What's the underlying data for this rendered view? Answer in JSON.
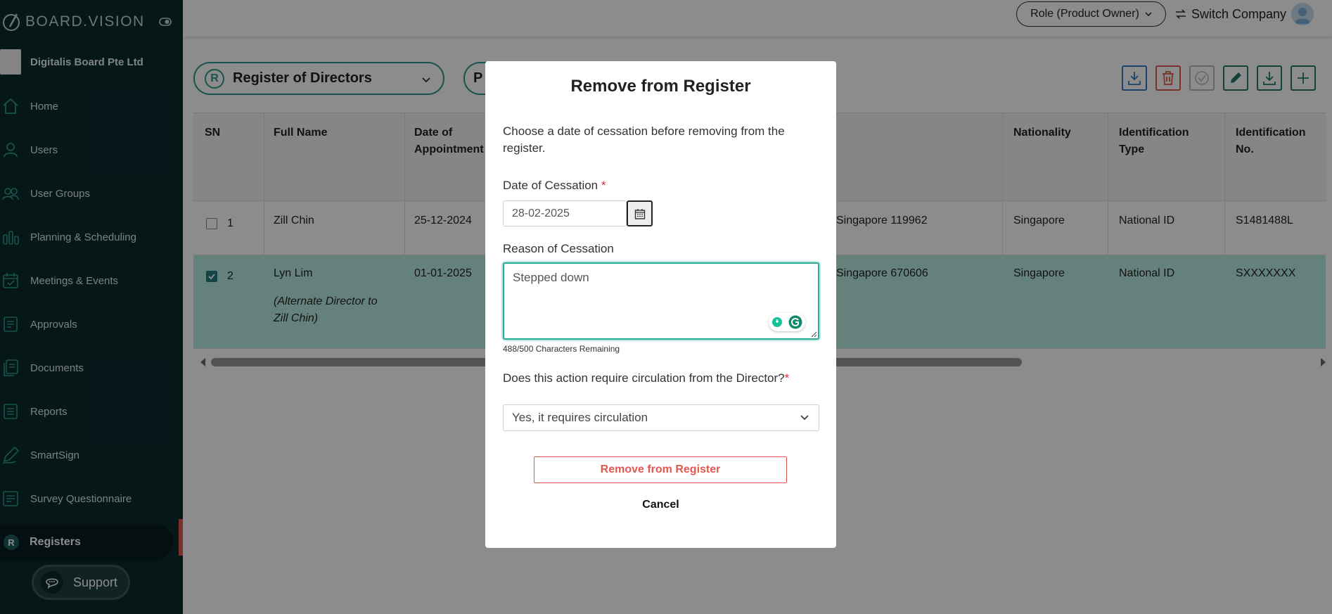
{
  "brand": {
    "name": "BOARD.VISION"
  },
  "company": {
    "name": "Digitalis Board Pte Ltd"
  },
  "nav": [
    {
      "label": "Home",
      "icon": "home-icon"
    },
    {
      "label": "Users",
      "icon": "user-icon"
    },
    {
      "label": "User Groups",
      "icon": "users-icon"
    },
    {
      "label": "Planning & Scheduling",
      "icon": "bar-chart-icon"
    },
    {
      "label": "Meetings & Events",
      "icon": "calendar-icon"
    },
    {
      "label": "Approvals",
      "icon": "approval-document-icon"
    },
    {
      "label": "Documents",
      "icon": "documents-icon"
    },
    {
      "label": "Reports",
      "icon": "report-icon"
    },
    {
      "label": "SmartSign",
      "icon": "pen-icon"
    },
    {
      "label": "Survey Questionnaire",
      "icon": "survey-icon"
    },
    {
      "label": "Registers",
      "icon": "register-icon",
      "active": true
    }
  ],
  "support": {
    "label": "Support"
  },
  "topbar": {
    "role": "Role (Product Owner)",
    "switch_company": "Switch Company"
  },
  "register_select": {
    "badge": "R",
    "label": "Register of Directors"
  },
  "second_pill": {
    "label": "P"
  },
  "table": {
    "headers": {
      "sn": "SN",
      "full_name": "Full Name",
      "date_of_appointment": "Date of Appointment",
      "nationality": "Nationality",
      "identification_type": "Identification Type",
      "identification_no": "Identification No."
    },
    "rows": [
      {
        "sn": "1",
        "checked": false,
        "full_name": "Zill Chin",
        "note": "",
        "date": "25-12-2024",
        "address": "Singapore 119962",
        "nationality": "Singapore",
        "id_type": "National ID",
        "id_no": "S1481488L"
      },
      {
        "sn": "2",
        "checked": true,
        "full_name": "Lyn Lim",
        "note": "(Alternate Director to Zill Chin)",
        "date": "01-01-2025",
        "address": "Singapore 670606",
        "nationality": "Singapore",
        "id_type": "National ID",
        "id_no": "SXXXXXXX"
      }
    ]
  },
  "modal": {
    "title": "Remove from Register",
    "description": "Choose a date of cessation before removing from the register.",
    "date_label": "Date of Cessation",
    "required_mark": "*",
    "date_value": "28-02-2025",
    "reason_label": "Reason of Cessation",
    "reason_value": "Stepped down",
    "chars_remaining": "488/500 Characters Remaining",
    "circulation_label": "Does this action require circulation from the Director?",
    "circulation_value": "Yes, it requires circulation",
    "remove_button": "Remove from Register",
    "cancel_button": "Cancel"
  },
  "colors": {
    "sidebar": "#0b2a2d",
    "accent": "#2e9a8c",
    "danger": "#e2584f",
    "selected_row": "#b9ece2"
  }
}
